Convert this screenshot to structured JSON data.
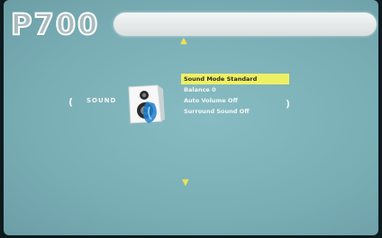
{
  "header": {
    "logo_text": "P700"
  },
  "nav": {
    "up_arrow": "▲",
    "down_arrow": "▼",
    "left_arrow": "(",
    "right_arrow": ")"
  },
  "section": {
    "label": "SOUND",
    "icon": "speaker-icon"
  },
  "menu": {
    "items": [
      {
        "label": "Sound Mode Standard",
        "selected": true
      },
      {
        "label": "Balance 0",
        "selected": false
      },
      {
        "label": "Auto Volume Off",
        "selected": false
      },
      {
        "label": "Surround Sound Off",
        "selected": false
      }
    ]
  },
  "colors": {
    "background": "#7aaeb5",
    "highlight": "#eef064",
    "arrow": "#e8e35a",
    "text": "#f4f6f6"
  }
}
